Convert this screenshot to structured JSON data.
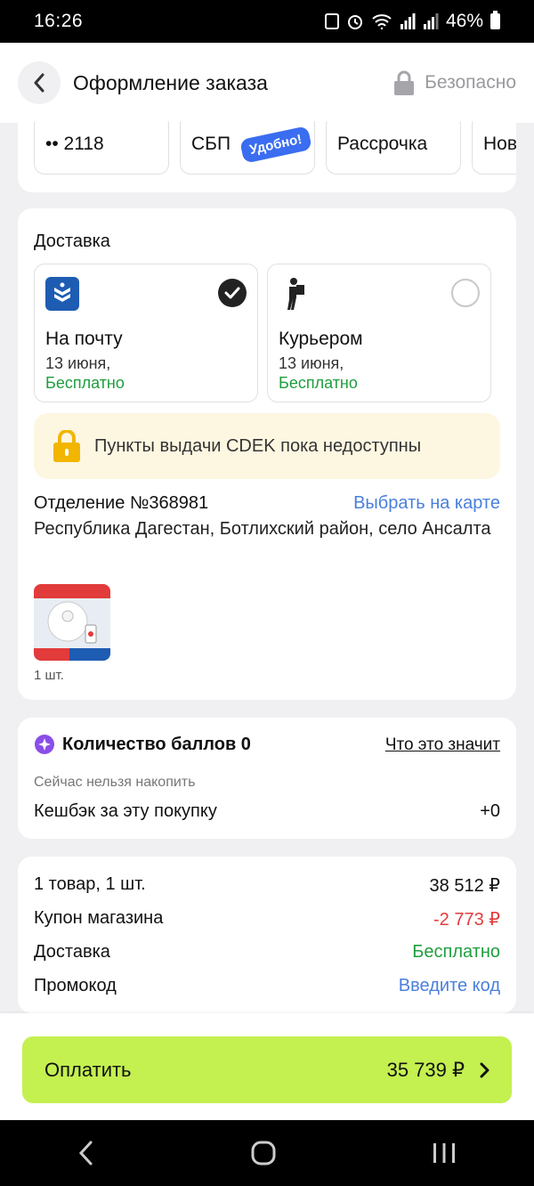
{
  "status_bar": {
    "time": "16:26",
    "battery": "46%"
  },
  "header": {
    "title": "Оформление заказа",
    "secure_label": "Безопасно"
  },
  "payment_methods": {
    "card_label": "•• 2118",
    "sbp_label": "СБП",
    "sbp_badge": "Удобно!",
    "installment_label": "Рассрочка",
    "new_label": "Нова"
  },
  "delivery": {
    "title": "Доставка",
    "options": [
      {
        "name": "На почту",
        "date": "13 июня,",
        "price": "Бесплатно",
        "selected": true
      },
      {
        "name": "Курьером",
        "date": "13 июня,",
        "price": "Бесплатно",
        "selected": false
      }
    ],
    "notice": "Пункты выдачи CDEK пока недоступны",
    "branch": "Отделение №368981",
    "map_link": "Выбрать на карте",
    "address": "Республика Дагестан, Ботлихский район, село Ансалта",
    "quantity": "1 шт."
  },
  "bonus": {
    "title": "Количество баллов 0",
    "link": "Что это значит",
    "subtitle": "Сейчас нельзя накопить",
    "cashback_label": "Кешбэк за эту покупку",
    "cashback_value": "+0"
  },
  "summary": {
    "items_label": "1 товар, 1 шт.",
    "items_value": "38 512 ₽",
    "coupon_label": "Купон магазина",
    "coupon_value": "-2 773 ₽",
    "delivery_label": "Доставка",
    "delivery_value": "Бесплатно",
    "promo_label": "Промокод",
    "promo_link": "Введите код"
  },
  "pay_button": {
    "label": "Оплатить",
    "amount": "35 739 ₽"
  },
  "colors": {
    "accent_green": "#c4f050",
    "link_blue": "#4a7fdc",
    "price_green": "#1e9e3e",
    "discount_red": "#e23b3b"
  }
}
